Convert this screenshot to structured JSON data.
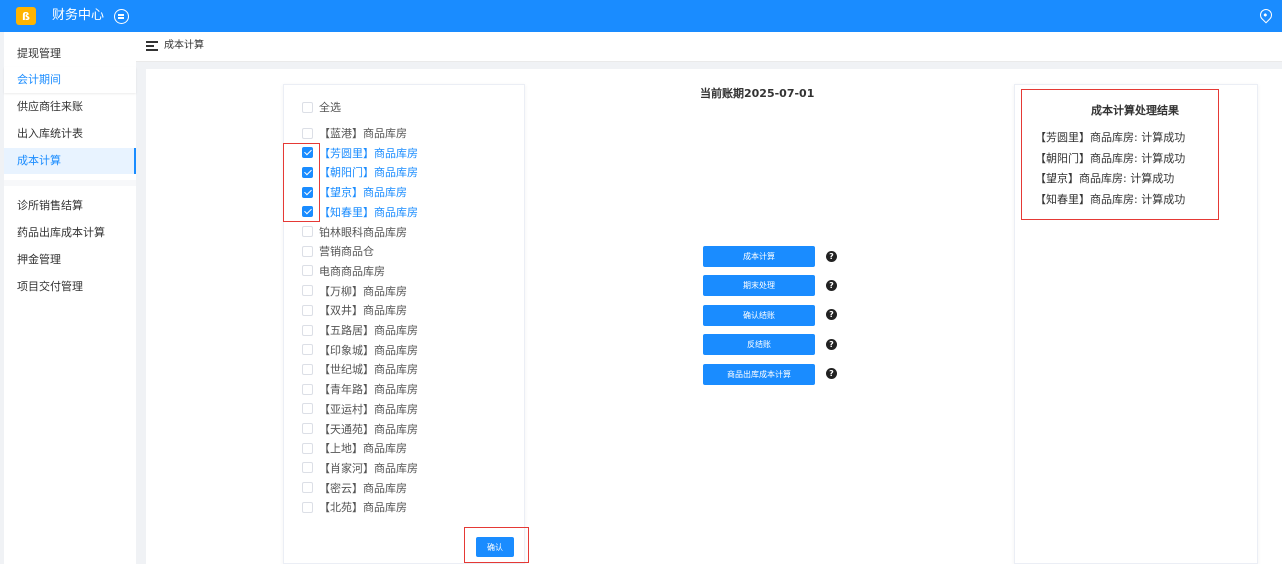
{
  "app": {
    "logo_glyph": "ß",
    "title": "财务中心",
    "switch_icon": "switch-icon",
    "location_icon": "location-pin-icon",
    "accent": "#1a8cff"
  },
  "sidebar": {
    "items": [
      {
        "label": "提现管理"
      },
      {
        "label": "会计期间"
      },
      {
        "label": "供应商往来账"
      },
      {
        "label": "出入库统计表"
      },
      {
        "label": "成本计算"
      },
      {
        "label": "诊所销售结算"
      },
      {
        "label": "药品出库成本计算"
      },
      {
        "label": "押金管理"
      },
      {
        "label": "项目交付管理"
      }
    ]
  },
  "breadcrumb": {
    "title": "成本计算"
  },
  "warehouses": {
    "select_all": "全选",
    "items": [
      {
        "label": "【蓝港】商品库房",
        "checked": false
      },
      {
        "label": "【芳圆里】商品库房",
        "checked": true
      },
      {
        "label": "【朝阳门】商品库房",
        "checked": true
      },
      {
        "label": "【望京】商品库房",
        "checked": true
      },
      {
        "label": "【知春里】商品库房",
        "checked": true
      },
      {
        "label": "铂林眼科商品库房",
        "checked": false
      },
      {
        "label": "营销商品仓",
        "checked": false
      },
      {
        "label": "电商商品库房",
        "checked": false
      },
      {
        "label": "【万柳】商品库房",
        "checked": false
      },
      {
        "label": "【双井】商品库房",
        "checked": false
      },
      {
        "label": "【五路居】商品库房",
        "checked": false
      },
      {
        "label": "【印象城】商品库房",
        "checked": false
      },
      {
        "label": "【世纪城】商品库房",
        "checked": false
      },
      {
        "label": "【青年路】商品库房",
        "checked": false
      },
      {
        "label": "【亚运村】商品库房",
        "checked": false
      },
      {
        "label": "【天通苑】商品库房",
        "checked": false
      },
      {
        "label": "【上地】商品库房",
        "checked": false
      },
      {
        "label": "【肖家河】商品库房",
        "checked": false
      },
      {
        "label": "【密云】商品库房",
        "checked": false
      },
      {
        "label": "【北苑】商品库房",
        "checked": false
      }
    ],
    "confirm_label": "确认"
  },
  "center": {
    "period_label": "当前账期2025-07-01",
    "actions": [
      {
        "label": "成本计算"
      },
      {
        "label": "期末处理"
      },
      {
        "label": "确认结账"
      },
      {
        "label": "反结账"
      },
      {
        "label": "商品出库成本计算"
      }
    ],
    "help_glyph": "?"
  },
  "result": {
    "title": "成本计算处理结果",
    "lines": [
      "【芳圆里】商品库房: 计算成功",
      "【朝阳门】商品库房: 计算成功",
      "【望京】商品库房: 计算成功",
      "【知春里】商品库房: 计算成功"
    ]
  },
  "highlight_color": "#e53935"
}
